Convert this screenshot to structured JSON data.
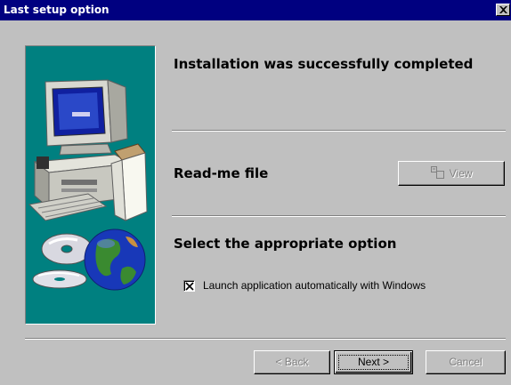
{
  "window": {
    "title": "Last setup option"
  },
  "sections": {
    "status_heading": "Installation was successfully completed",
    "readme_heading": "Read-me file",
    "option_heading": "Select the appropriate option"
  },
  "readme": {
    "view_button_label": "View",
    "view_button_icon": "document-view-icon"
  },
  "options": {
    "launch_label": "Launch application automatically with Windows",
    "launch_checked": true
  },
  "footer": {
    "back_label": "< Back",
    "next_label": "Next >",
    "cancel_label": "Cancel"
  },
  "colors": {
    "titlebar": "#000080",
    "dialog_face": "#c0c0c0",
    "side_panel": "#008080"
  }
}
